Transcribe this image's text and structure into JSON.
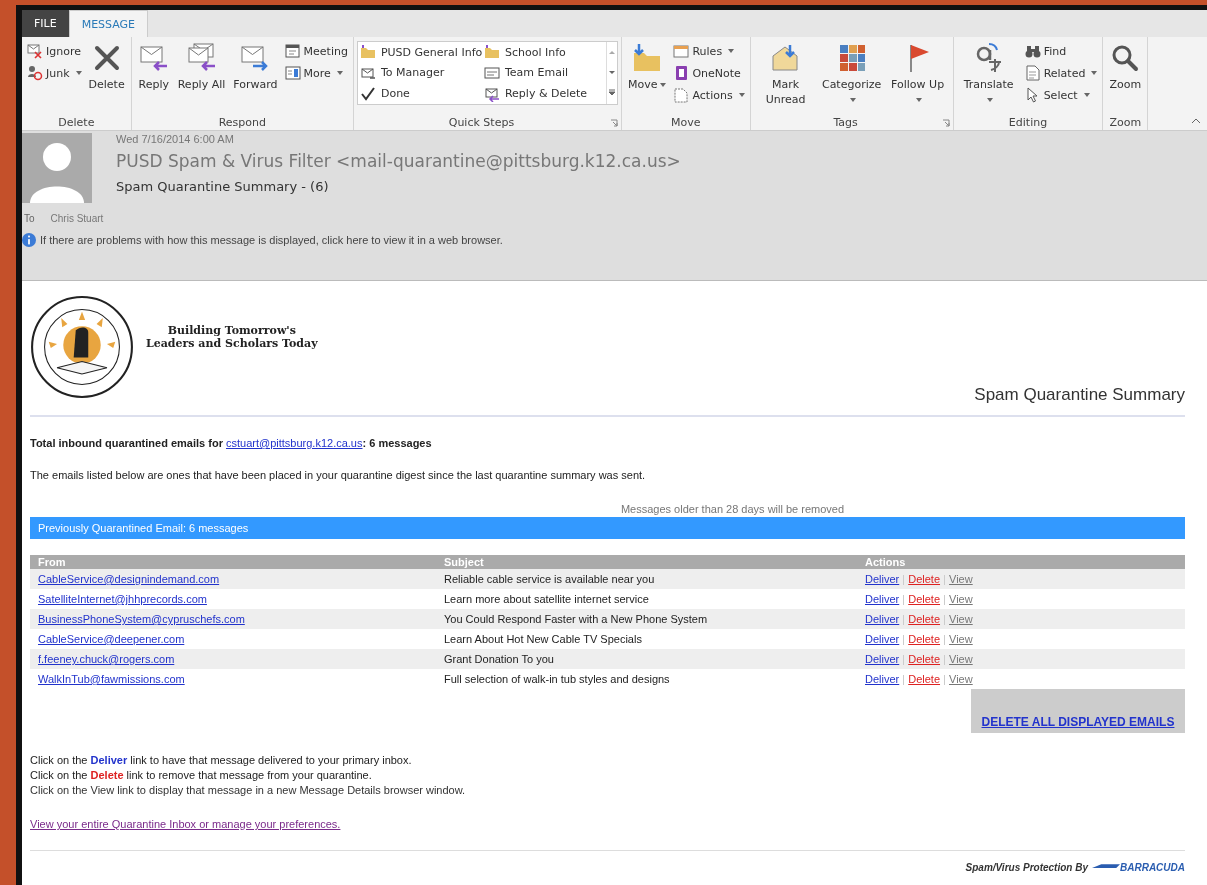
{
  "ribbon": {
    "tabs": [
      {
        "label": "FILE",
        "kind": "file",
        "selected": false
      },
      {
        "label": "MESSAGE",
        "kind": "tab",
        "selected": true
      }
    ],
    "groups": [
      {
        "label": "Delete",
        "columns": [
          [
            {
              "kind": "small",
              "label": "Ignore",
              "dropdown": false
            },
            {
              "kind": "small",
              "label": "Junk",
              "dropdown": true
            }
          ],
          [
            {
              "kind": "large",
              "label": "Delete",
              "dropdown": false
            }
          ]
        ]
      },
      {
        "label": "Respond",
        "columns": [
          [
            {
              "kind": "large",
              "label": "Reply",
              "dropdown": false
            }
          ],
          [
            {
              "kind": "large",
              "label": "Reply All",
              "dropdown": false
            }
          ],
          [
            {
              "kind": "large",
              "label": "Forward",
              "dropdown": false
            }
          ],
          [
            {
              "kind": "small",
              "label": "Meeting",
              "dropdown": false
            },
            {
              "kind": "small",
              "label": "More",
              "dropdown": true
            }
          ]
        ]
      },
      {
        "label": "Quick Steps",
        "launcher": true,
        "columns": [
          [
            {
              "kind": "gallery",
              "steps": [
                "PUSD General Info",
                "School Info",
                "To Manager",
                "Team Email",
                "Done",
                "Reply & Delete"
              ]
            }
          ]
        ]
      },
      {
        "label": "Move",
        "columns": [
          [
            {
              "kind": "large",
              "label": "Move",
              "dropdown": true
            }
          ],
          [
            {
              "kind": "small",
              "label": "Rules",
              "dropdown": true
            },
            {
              "kind": "small",
              "label": "OneNote",
              "dropdown": false
            },
            {
              "kind": "small",
              "label": "Actions",
              "dropdown": true
            }
          ]
        ]
      },
      {
        "label": "Tags",
        "launcher": true,
        "columns": [
          [
            {
              "kind": "large",
              "label": "Mark Unread",
              "dropdown": false
            }
          ],
          [
            {
              "kind": "large",
              "label": "Categorize",
              "dropdown": true
            }
          ],
          [
            {
              "kind": "large",
              "label": "Follow Up",
              "dropdown": true
            }
          ]
        ]
      },
      {
        "label": "Editing",
        "columns": [
          [
            {
              "kind": "large",
              "label": "Translate",
              "dropdown": true
            }
          ],
          [
            {
              "kind": "small",
              "label": "Find",
              "dropdown": false
            },
            {
              "kind": "small",
              "label": "Related",
              "dropdown": true
            },
            {
              "kind": "small",
              "label": "Select",
              "dropdown": true
            }
          ]
        ]
      },
      {
        "label": "Zoom",
        "columns": [
          [
            {
              "kind": "large",
              "label": "Zoom",
              "dropdown": false
            }
          ]
        ]
      }
    ]
  },
  "header": {
    "date": "Wed 7/16/2014 6:00 AM",
    "sender": "PUSD Spam & Virus Filter <mail-quarantine@pittsburg.k12.ca.us>",
    "subject": "Spam Quarantine Summary - (6)",
    "to_label": "To",
    "to": "Chris Stuart",
    "info": "If there are problems with how this message is displayed, click here to view it in a web browser."
  },
  "body": {
    "tagline": [
      "Building Tomorrow's",
      "Leaders and Scholars Today"
    ],
    "title": "Spam Quarantine Summary",
    "total": {
      "prefix": "Total inbound quarantined emails for ",
      "address": "cstuart@pittsburg.k12.ca.us",
      "suffix": ": 6 messages"
    },
    "description": "The emails listed below are ones that have been placed in your quarantine digest since the last quarantine summary was sent.",
    "notice": "Messages older than 28 days will be removed",
    "bar": "Previously Quarantined Email: 6 messages",
    "table": {
      "columns": [
        "From",
        "Subject",
        "Actions"
      ],
      "rows": [
        {
          "from": "CableService@designindemand.com",
          "subject": "Reliable cable service is available near you",
          "actions": [
            {
              "kind": "deliver",
              "label": "Deliver"
            },
            {
              "kind": "delete",
              "label": "Delete"
            },
            {
              "kind": "view",
              "label": "View"
            }
          ]
        },
        {
          "from": "SatelliteInternet@jhhprecords.com",
          "subject": "Learn more about satellite internet service",
          "actions": [
            {
              "kind": "deliver",
              "label": "Deliver"
            },
            {
              "kind": "delete",
              "label": "Delete"
            },
            {
              "kind": "view",
              "label": "View"
            }
          ]
        },
        {
          "from": "BusinessPhoneSystem@cypruschefs.com",
          "subject": "You Could Respond Faster with a New Phone System",
          "actions": [
            {
              "kind": "deliver",
              "label": "Deliver"
            },
            {
              "kind": "delete",
              "label": "Delete"
            },
            {
              "kind": "view",
              "label": "View"
            }
          ]
        },
        {
          "from": "CableService@deepener.com",
          "subject": "Learn About Hot New Cable TV Specials",
          "actions": [
            {
              "kind": "deliver",
              "label": "Deliver"
            },
            {
              "kind": "delete",
              "label": "Delete"
            },
            {
              "kind": "view",
              "label": "View"
            }
          ]
        },
        {
          "from": "f.feeney.chuck@rogers.com",
          "subject": "Grant Donation To you",
          "actions": [
            {
              "kind": "deliver",
              "label": "Deliver"
            },
            {
              "kind": "delete",
              "label": "Delete"
            },
            {
              "kind": "view",
              "label": "View"
            }
          ]
        },
        {
          "from": "WalkInTub@fawmissions.com",
          "subject": "Full selection of walk-in tub styles and designs",
          "actions": [
            {
              "kind": "deliver",
              "label": "Deliver"
            },
            {
              "kind": "delete",
              "label": "Delete"
            },
            {
              "kind": "view",
              "label": "View"
            }
          ]
        }
      ]
    },
    "delete_all": "DELETE ALL DISPLAYED EMAILS",
    "instructions": [
      {
        "kind": "deliver",
        "text": "Click on the **Deliver** link to have that message delivered to your primary inbox."
      },
      {
        "kind": "delete",
        "text": "Click on the **Delete** link to remove that message from your quarantine."
      },
      {
        "kind": "view",
        "text": "Click on the View link to display that message in a new Message Details browser window."
      }
    ],
    "manage_link": "View your entire Quarantine Inbox or manage your preferences.",
    "protection": "Spam/Virus Protection By",
    "vendor": "BARRACUDA"
  }
}
